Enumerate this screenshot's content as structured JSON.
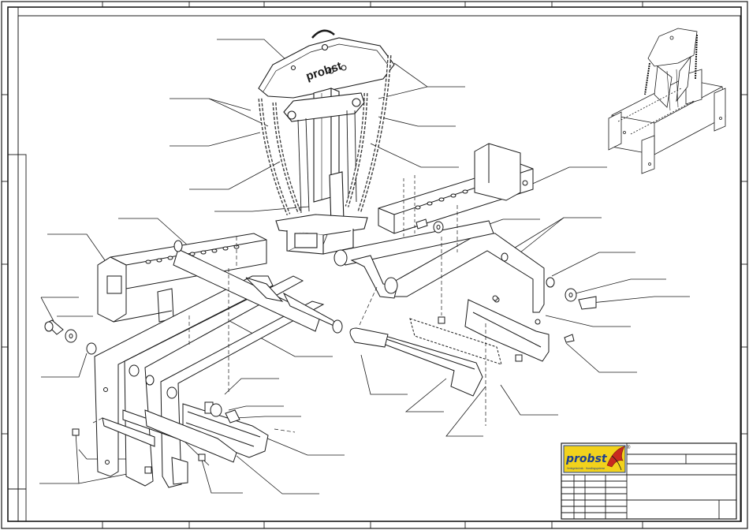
{
  "drawing": {
    "brand_engraving": "probst",
    "title_block": {
      "logo_text": "probst",
      "logo_tagline": "Verlegetechnik · Handlingsysteme",
      "registered_mark": "®"
    }
  },
  "colors": {
    "line": "#1a1a1a",
    "paper": "#ffffff",
    "logo_yellow": "#f2d21c",
    "logo_blue": "#1d3f8f",
    "logo_red": "#c8291f"
  }
}
